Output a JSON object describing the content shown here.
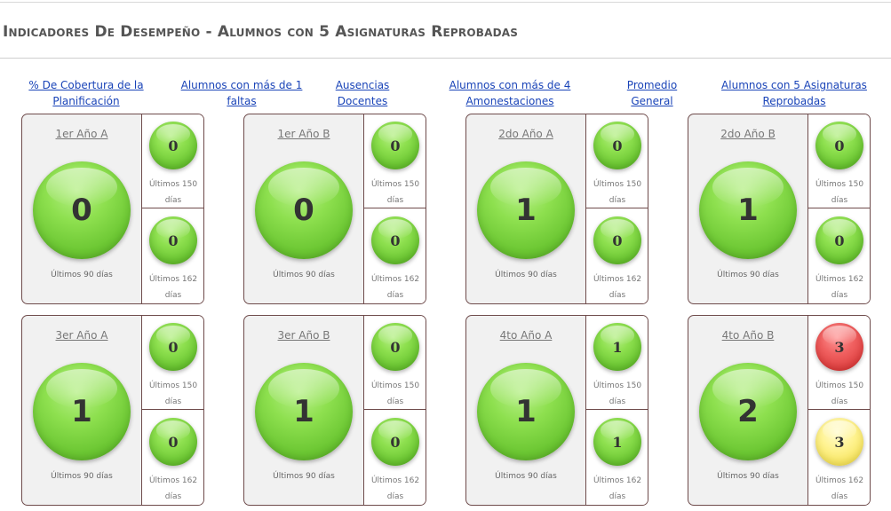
{
  "page": {
    "title": "Indicadores De Desempeño - Alumnos con 5 Asignaturas Reprobadas"
  },
  "nav": [
    {
      "label": "% De Cobertura de la Planificación"
    },
    {
      "label": "Alumnos con más de 1 faltas"
    },
    {
      "label": "Ausencias Docentes"
    },
    {
      "label": "Alumnos con más de 4 Amonestaciones"
    },
    {
      "label": "Promedio General"
    },
    {
      "label": "Alumnos con 5 Asignaturas Reprobadas"
    }
  ],
  "colors": {
    "green": "#7ed245",
    "red": "#e84a4a",
    "yellow": "#f8e96a",
    "link": "#1a44b8",
    "card_border": "#6e4b4b"
  },
  "cards": [
    {
      "course": "1er Año A",
      "main_value": "0",
      "main_caption": "Últimos 90 días",
      "top_value": "0",
      "top_color": "green",
      "top_caption": "Últimos 150 días",
      "bottom_value": "0",
      "bottom_color": "green",
      "bottom_caption": "Últimos 162 días"
    },
    {
      "course": "1er Año B",
      "main_value": "0",
      "main_caption": "Últimos 90 días",
      "top_value": "0",
      "top_color": "green",
      "top_caption": "Últimos 150 días",
      "bottom_value": "0",
      "bottom_color": "green",
      "bottom_caption": "Últimos 162 días"
    },
    {
      "course": "2do Año A",
      "main_value": "1",
      "main_caption": "Últimos 90 días",
      "top_value": "0",
      "top_color": "green",
      "top_caption": "Últimos 150 días",
      "bottom_value": "0",
      "bottom_color": "green",
      "bottom_caption": "Últimos 162 días"
    },
    {
      "course": "2do Año B",
      "main_value": "1",
      "main_caption": "Últimos 90 días",
      "top_value": "0",
      "top_color": "green",
      "top_caption": "Últimos 150 días",
      "bottom_value": "0",
      "bottom_color": "green",
      "bottom_caption": "Últimos 162 días"
    },
    {
      "course": "3er Año A",
      "main_value": "1",
      "main_caption": "Últimos 90 días",
      "top_value": "0",
      "top_color": "green",
      "top_caption": "Últimos 150 días",
      "bottom_value": "0",
      "bottom_color": "green",
      "bottom_caption": "Últimos 162 días"
    },
    {
      "course": "3er Año B",
      "main_value": "1",
      "main_caption": "Últimos 90 días",
      "top_value": "0",
      "top_color": "green",
      "top_caption": "Últimos 150 días",
      "bottom_value": "0",
      "bottom_color": "green",
      "bottom_caption": "Últimos 162 días"
    },
    {
      "course": "4to Año A",
      "main_value": "1",
      "main_caption": "Últimos 90 días",
      "top_value": "1",
      "top_color": "green",
      "top_caption": "Últimos 150 días",
      "bottom_value": "1",
      "bottom_color": "green",
      "bottom_caption": "Últimos 162 días"
    },
    {
      "course": "4to Año B",
      "main_value": "2",
      "main_caption": "Últimos 90 días",
      "top_value": "3",
      "top_color": "red",
      "top_caption": "Últimos 150 días",
      "bottom_value": "3",
      "bottom_color": "yellow",
      "bottom_caption": "Últimos 162 días"
    }
  ]
}
